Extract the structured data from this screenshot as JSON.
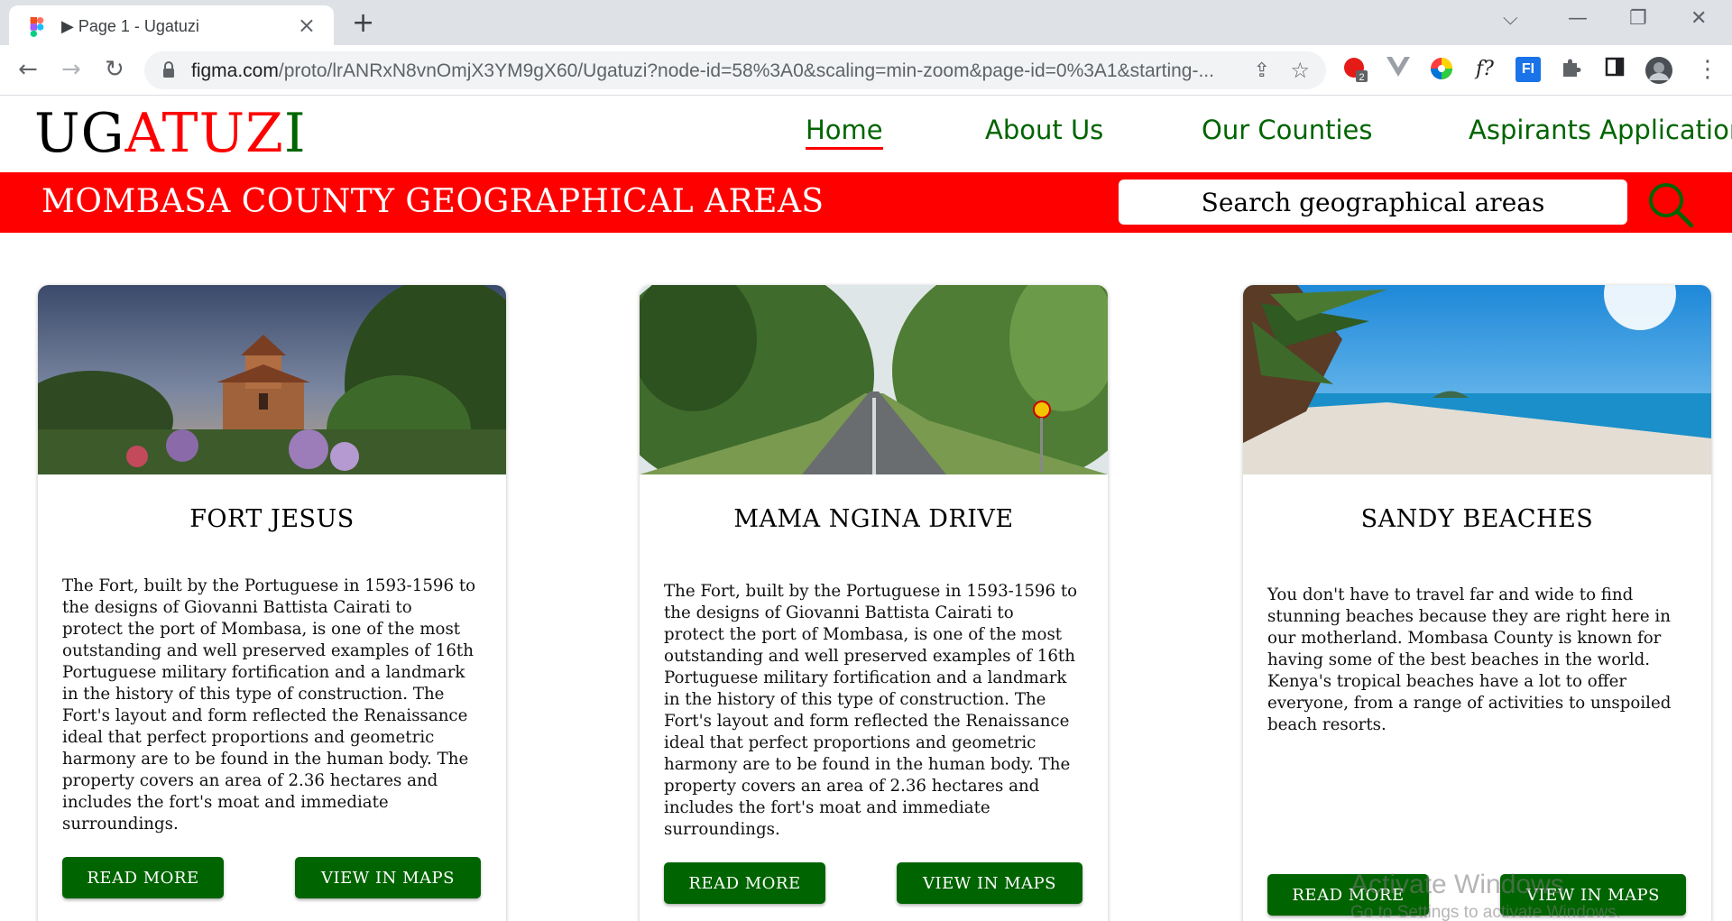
{
  "browser": {
    "tab_title": "▶ Page 1 - Ugatuzi",
    "new_tab": "+",
    "url_host": "figma.com",
    "url_path": "/proto/lrANRxN8vnOmjX3YM9gX60/Ugatuzi?node-id=58%3A0&scaling=min-zoom&page-id=0%3A1&starting-...",
    "ext_badge": "2",
    "ext_fx": "f?",
    "ext_fi": "FI"
  },
  "site": {
    "logo": {
      "part1": "UG",
      "part2": "ATUZ",
      "part3": "I"
    },
    "nav": [
      {
        "label": "Home",
        "active": true
      },
      {
        "label": "About Us"
      },
      {
        "label": "Our Counties"
      },
      {
        "label": "Aspirants Application"
      }
    ],
    "banner": {
      "title": "MOMBASA COUNTY GEOGRAPHICAL AREAS",
      "search_placeholder": "Search geographical areas"
    },
    "cards": [
      {
        "image": "castle-photo",
        "title": "FORT JESUS",
        "body": "The Fort, built by the Portuguese in 1593-1596 to the designs of Giovanni Battista Cairati to protect the port of Mombasa, is one of the most outstanding and well preserved examples of 16th Portuguese military fortification and a landmark in the history of this type of construction. The Fort's layout and form reflected the Renaissance ideal that perfect proportions and geometric harmony are to be found in the human body. The property covers an area of 2.36 hectares and includes the fort's moat and immediate surroundings.",
        "read_more": "READ MORE",
        "view_maps": "VIEW IN MAPS"
      },
      {
        "image": "forest-road-photo",
        "title": "MAMA NGINA DRIVE",
        "body": "The Fort, built by the Portuguese in 1593-1596 to the designs of Giovanni Battista Cairati to protect the port of Mombasa, is one of the most outstanding and well preserved examples of 16th Portuguese military fortification and a landmark in the history of this type of construction. The Fort's layout and form reflected the Renaissance ideal that perfect proportions and geometric harmony are to be found in the human body. The property covers an area of 2.36 hectares and includes the fort's moat and immediate surroundings.",
        "read_more": "READ MORE",
        "view_maps": "VIEW IN MAPS"
      },
      {
        "image": "beach-photo",
        "title": "SANDY BEACHES",
        "body": "You don't have to travel far and wide to find stunning beaches because they are right here in our motherland. Mombasa County is known for having some of the best beaches in the world. Kenya's tropical beaches have a lot to offer everyone, from a range of activities to unspoiled beach resorts.",
        "read_more": "READ MORE",
        "view_maps": "VIEW IN MAPS"
      }
    ]
  },
  "os_watermark": {
    "line1": "Activate Windows",
    "line2": "Go to Settings to activate Windows."
  },
  "colors": {
    "brand_red": "#ff0000",
    "brand_green": "#006400",
    "chrome_gray": "#dee1e6"
  }
}
